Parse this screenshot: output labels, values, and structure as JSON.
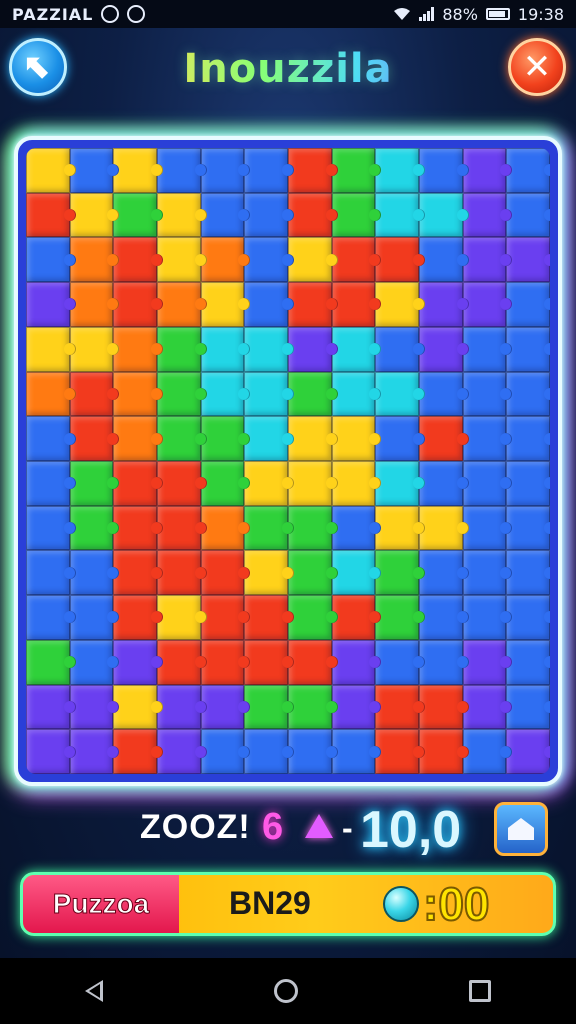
{
  "status_bar": {
    "carrier": "PAZZIAL",
    "battery": "88%",
    "time": "19:38"
  },
  "header": {
    "title": "Inouzzila",
    "back_icon": "back-arrow-icon",
    "close_icon": "close-x-icon",
    "back_glyph": "⬉",
    "close_glyph": "✕"
  },
  "board": {
    "columns": 12,
    "rows": 14,
    "colors": {
      "R": "#f23a1e",
      "O": "#ff7a12",
      "Y": "#ffd21a",
      "G": "#2fd13a",
      "C": "#22d6e6",
      "B": "#2f6ef2",
      "P": "#6a3ff0",
      "V": "#8b3fe6"
    },
    "grid": [
      "YBYBBBRGCBPB",
      "RYGYBBRGCCPB",
      "BORYOBYRRBPP",
      "POROYBRRYPPB",
      "YYOGCCPCBPBB",
      "OROGCCGCCBBB",
      "BROGGCYYBRBB",
      "BGRRGYYYCBBB",
      "BGRROGGBYYBB",
      "BBRRRYGCGBBB",
      "BBRYRRGRGBBB",
      "GBPRRRRPBBPB",
      "PPYPPGGPRRPB",
      "PPRPBBBBRRBP"
    ]
  },
  "score_row": {
    "combo_text": "ZOOZ!",
    "multiplier_text": "6",
    "dash_text": "-",
    "score_text": "10,0",
    "shop_icon": "house-icon"
  },
  "bottom_bar": {
    "puzzle_label": "Puzzoa",
    "level_label": "BN29",
    "gem_icon": "gem-icon",
    "timer_text": ":00"
  },
  "nav_bar": {
    "back_icon": "nav-back-icon",
    "home_icon": "nav-home-icon",
    "recent_icon": "nav-recent-icon"
  }
}
